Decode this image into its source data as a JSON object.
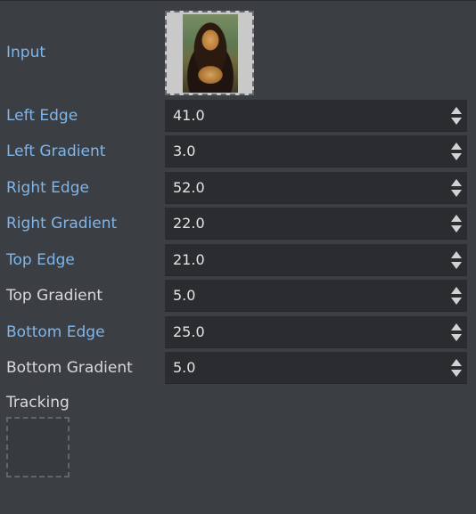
{
  "input": {
    "label": "Input"
  },
  "fields": [
    {
      "label": "Left Edge",
      "value": "41.0",
      "label_style": "link"
    },
    {
      "label": "Left Gradient",
      "value": "3.0",
      "label_style": "link"
    },
    {
      "label": "Right Edge",
      "value": "52.0",
      "label_style": "link"
    },
    {
      "label": "Right Gradient",
      "value": "22.0",
      "label_style": "link"
    },
    {
      "label": "Top Edge",
      "value": "21.0",
      "label_style": "link"
    },
    {
      "label": "Top Gradient",
      "value": "5.0",
      "label_style": "plain"
    },
    {
      "label": "Bottom Edge",
      "value": "25.0",
      "label_style": "link"
    },
    {
      "label": "Bottom Gradient",
      "value": "5.0",
      "label_style": "plain"
    }
  ],
  "tracking": {
    "label": "Tracking"
  },
  "colors": {
    "background": "#3b3e43",
    "field_background": "#2a2c30",
    "link_label": "#7fb6ea",
    "plain_label": "#d9d9d9",
    "value_text": "#e3e3e3"
  },
  "icons": {
    "spinner_up": "triangle-up",
    "spinner_down": "triangle-down"
  }
}
